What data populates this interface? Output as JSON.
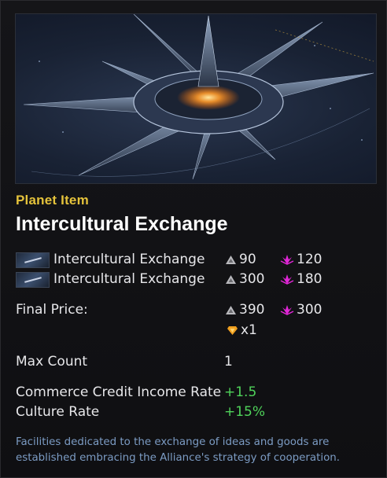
{
  "card": {
    "category": "Planet Item",
    "title": "Intercultural Exchange"
  },
  "components": [
    {
      "name": "Intercultural Exchange",
      "metal": "90",
      "crystal": "120"
    },
    {
      "name": "Intercultural Exchange",
      "metal": "300",
      "crystal": "180"
    }
  ],
  "final_price": {
    "label": "Final Price:",
    "metal": "390",
    "crystal": "300",
    "gem": "x1"
  },
  "max_count": {
    "label": "Max Count",
    "value": "1"
  },
  "stats": [
    {
      "label": "Commerce Credit Income Rate",
      "value": "+1.5"
    },
    {
      "label": "Culture Rate",
      "value": "+15%"
    }
  ],
  "description": "Facilities dedicated to the exchange of ideas and goods are established embracing the Alliance's strategy of cooperation.",
  "colors": {
    "category": "#e4c23b",
    "stat_positive": "#4fd35a",
    "description": "#7c9cc4",
    "crystal_icon": "#e026d6",
    "gem_icon": "#f0a020"
  },
  "icons": {
    "metal": "metal-resource-icon",
    "crystal": "crystal-resource-icon",
    "gem": "gem-icon"
  }
}
